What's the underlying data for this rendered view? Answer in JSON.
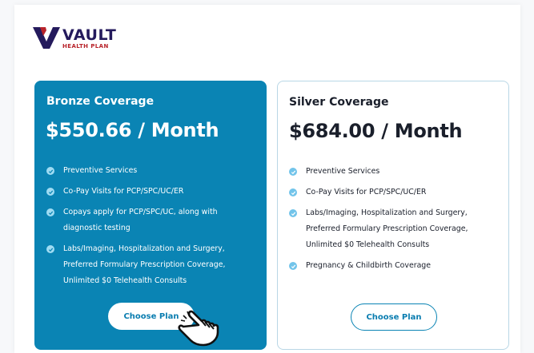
{
  "brand": {
    "name": "VAULT",
    "tagline": "HEALTH PLAN",
    "colors": {
      "primary": "#241a5c",
      "accent": "#b8232a"
    }
  },
  "plans": [
    {
      "title": "Bronze Coverage",
      "price": "$550.66 / Month",
      "features": [
        "Preventive Services",
        "Co-Pay Visits for PCP/SPC/UC/ER",
        "Copays apply for PCP/SPC/UC, along with diagnostic testing",
        "Labs/Imaging, Hospitalization and Surgery, Preferred Formulary Prescription Coverage, Unlimited $0 Telehealth Consults"
      ],
      "button_label": "Choose Plan",
      "color": "#0a84b4"
    },
    {
      "title": "Silver Coverage",
      "price": "$684.00 / Month",
      "features": [
        "Preventive Services",
        "Co-Pay Visits for PCP/SPC/UC/ER",
        "Labs/Imaging, Hospitalization and Surgery, Preferred Formulary Prescription Coverage, Unlimited $0 Telehealth Consults",
        "Pregnancy & Childbirth Coverage"
      ],
      "button_label": "Choose Plan",
      "color": "#ffffff"
    }
  ],
  "icons": {
    "check": "check-circle-icon",
    "cursor": "hand-pointer-cursor-icon"
  }
}
